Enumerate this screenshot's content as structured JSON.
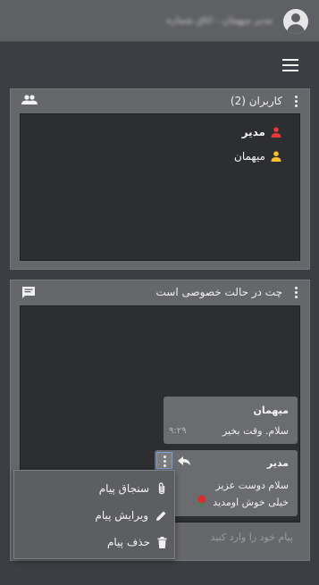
{
  "topbar": {
    "title": "مدیر میهمان - اتاق شماره"
  },
  "users_panel": {
    "title": "کاربران (2)",
    "users": [
      {
        "name": "مدیر",
        "color": "#e53935"
      },
      {
        "name": "میهمان",
        "color": "#fbc02d"
      }
    ]
  },
  "chat_panel": {
    "title": "چت در حالت خصوصی است",
    "messages": [
      {
        "sender": "میهمان",
        "text": "سلام. وقت بخیر",
        "time": "۹:۲۹"
      },
      {
        "sender": "مدیر",
        "lines": [
          "سلام دوست عزیز",
          "خیلی خوش اومدید"
        ]
      }
    ],
    "input_placeholder": "پیام خود را وارد کنید"
  },
  "context_menu": {
    "items": [
      {
        "label": "سنجاق پیام",
        "icon": "paperclip-icon"
      },
      {
        "label": "ویرایش پیام",
        "icon": "pencil-icon"
      },
      {
        "label": "حذف پیام",
        "icon": "trash-icon"
      }
    ]
  },
  "colors": {
    "background": "#3b3e42",
    "panel": "#66676b",
    "inner": "#2c2e31",
    "admin": "#e53935",
    "guest": "#fbc02d"
  }
}
